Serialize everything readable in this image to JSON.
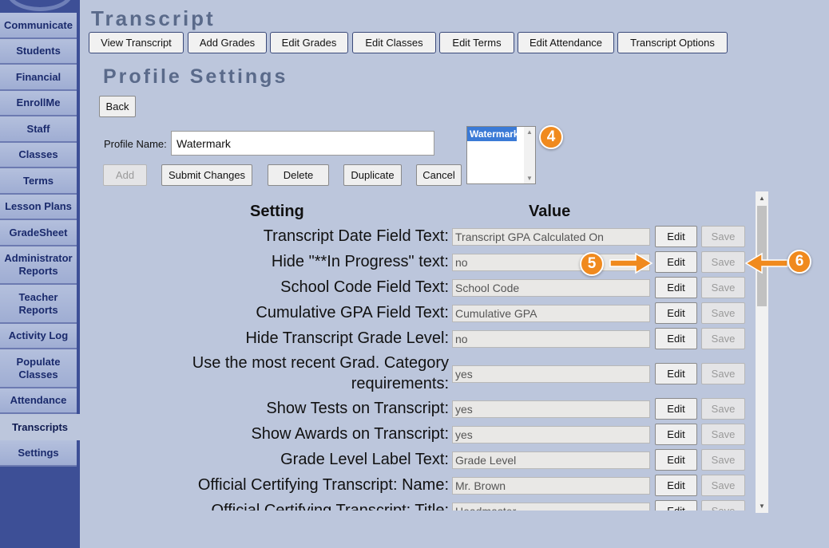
{
  "sidebar": {
    "items": [
      {
        "label": "Communicate"
      },
      {
        "label": "Students"
      },
      {
        "label": "Financial"
      },
      {
        "label": "EnrollMe"
      },
      {
        "label": "Staff"
      },
      {
        "label": "Classes"
      },
      {
        "label": "Terms"
      },
      {
        "label": "Lesson Plans"
      },
      {
        "label": "GradeSheet"
      },
      {
        "label": "Administrator Reports"
      },
      {
        "label": "Teacher Reports"
      },
      {
        "label": "Activity Log"
      },
      {
        "label": "Populate Classes"
      },
      {
        "label": "Attendance"
      },
      {
        "label": "Transcripts",
        "active": true
      },
      {
        "label": "Settings"
      }
    ]
  },
  "header": {
    "title": "Transcript",
    "tabs": [
      {
        "label": "View Transcript"
      },
      {
        "label": "Add Grades"
      },
      {
        "label": "Edit Grades"
      },
      {
        "label": "Edit Classes"
      },
      {
        "label": "Edit Terms"
      },
      {
        "label": "Edit Attendance"
      },
      {
        "label": "Transcript Options"
      }
    ]
  },
  "section": {
    "title": "Profile Settings",
    "back_label": "Back"
  },
  "profile": {
    "name_label": "Profile Name:",
    "name_value": "Watermark",
    "list_options": [
      "Watermark"
    ],
    "actions": {
      "add": "Add",
      "submit": "Submit Changes",
      "delete": "Delete",
      "duplicate": "Duplicate",
      "cancel": "Cancel"
    }
  },
  "settings": {
    "header_setting": "Setting",
    "header_value": "Value",
    "edit_label": "Edit",
    "save_label": "Save",
    "rows": [
      {
        "label": "Transcript Date Field Text:",
        "value": "Transcript GPA Calculated On"
      },
      {
        "label": "Hide \"**In Progress\" text:",
        "value": "no"
      },
      {
        "label": "School Code Field Text:",
        "value": "School Code"
      },
      {
        "label": "Cumulative GPA Field Text:",
        "value": "Cumulative GPA"
      },
      {
        "label": "Hide Transcript Grade Level:",
        "value": "no"
      },
      {
        "label": "Use the most recent Grad. Category requirements:",
        "value": "yes"
      },
      {
        "label": "Show Tests on Transcript:",
        "value": "yes"
      },
      {
        "label": "Show Awards on Transcript:",
        "value": "yes"
      },
      {
        "label": "Grade Level Label Text:",
        "value": "Grade Level"
      },
      {
        "label": "Official Certifying Transcript: Name:",
        "value": "Mr. Brown"
      },
      {
        "label": "Official Certifying Transcript: Title:",
        "value": "Headmaster"
      }
    ]
  },
  "callouts": [
    "4",
    "5",
    "6"
  ],
  "colors": {
    "accent_orange": "#f08a1e",
    "sidebar_bg": "#3d4f96",
    "page_bg": "#bcc6dc"
  }
}
